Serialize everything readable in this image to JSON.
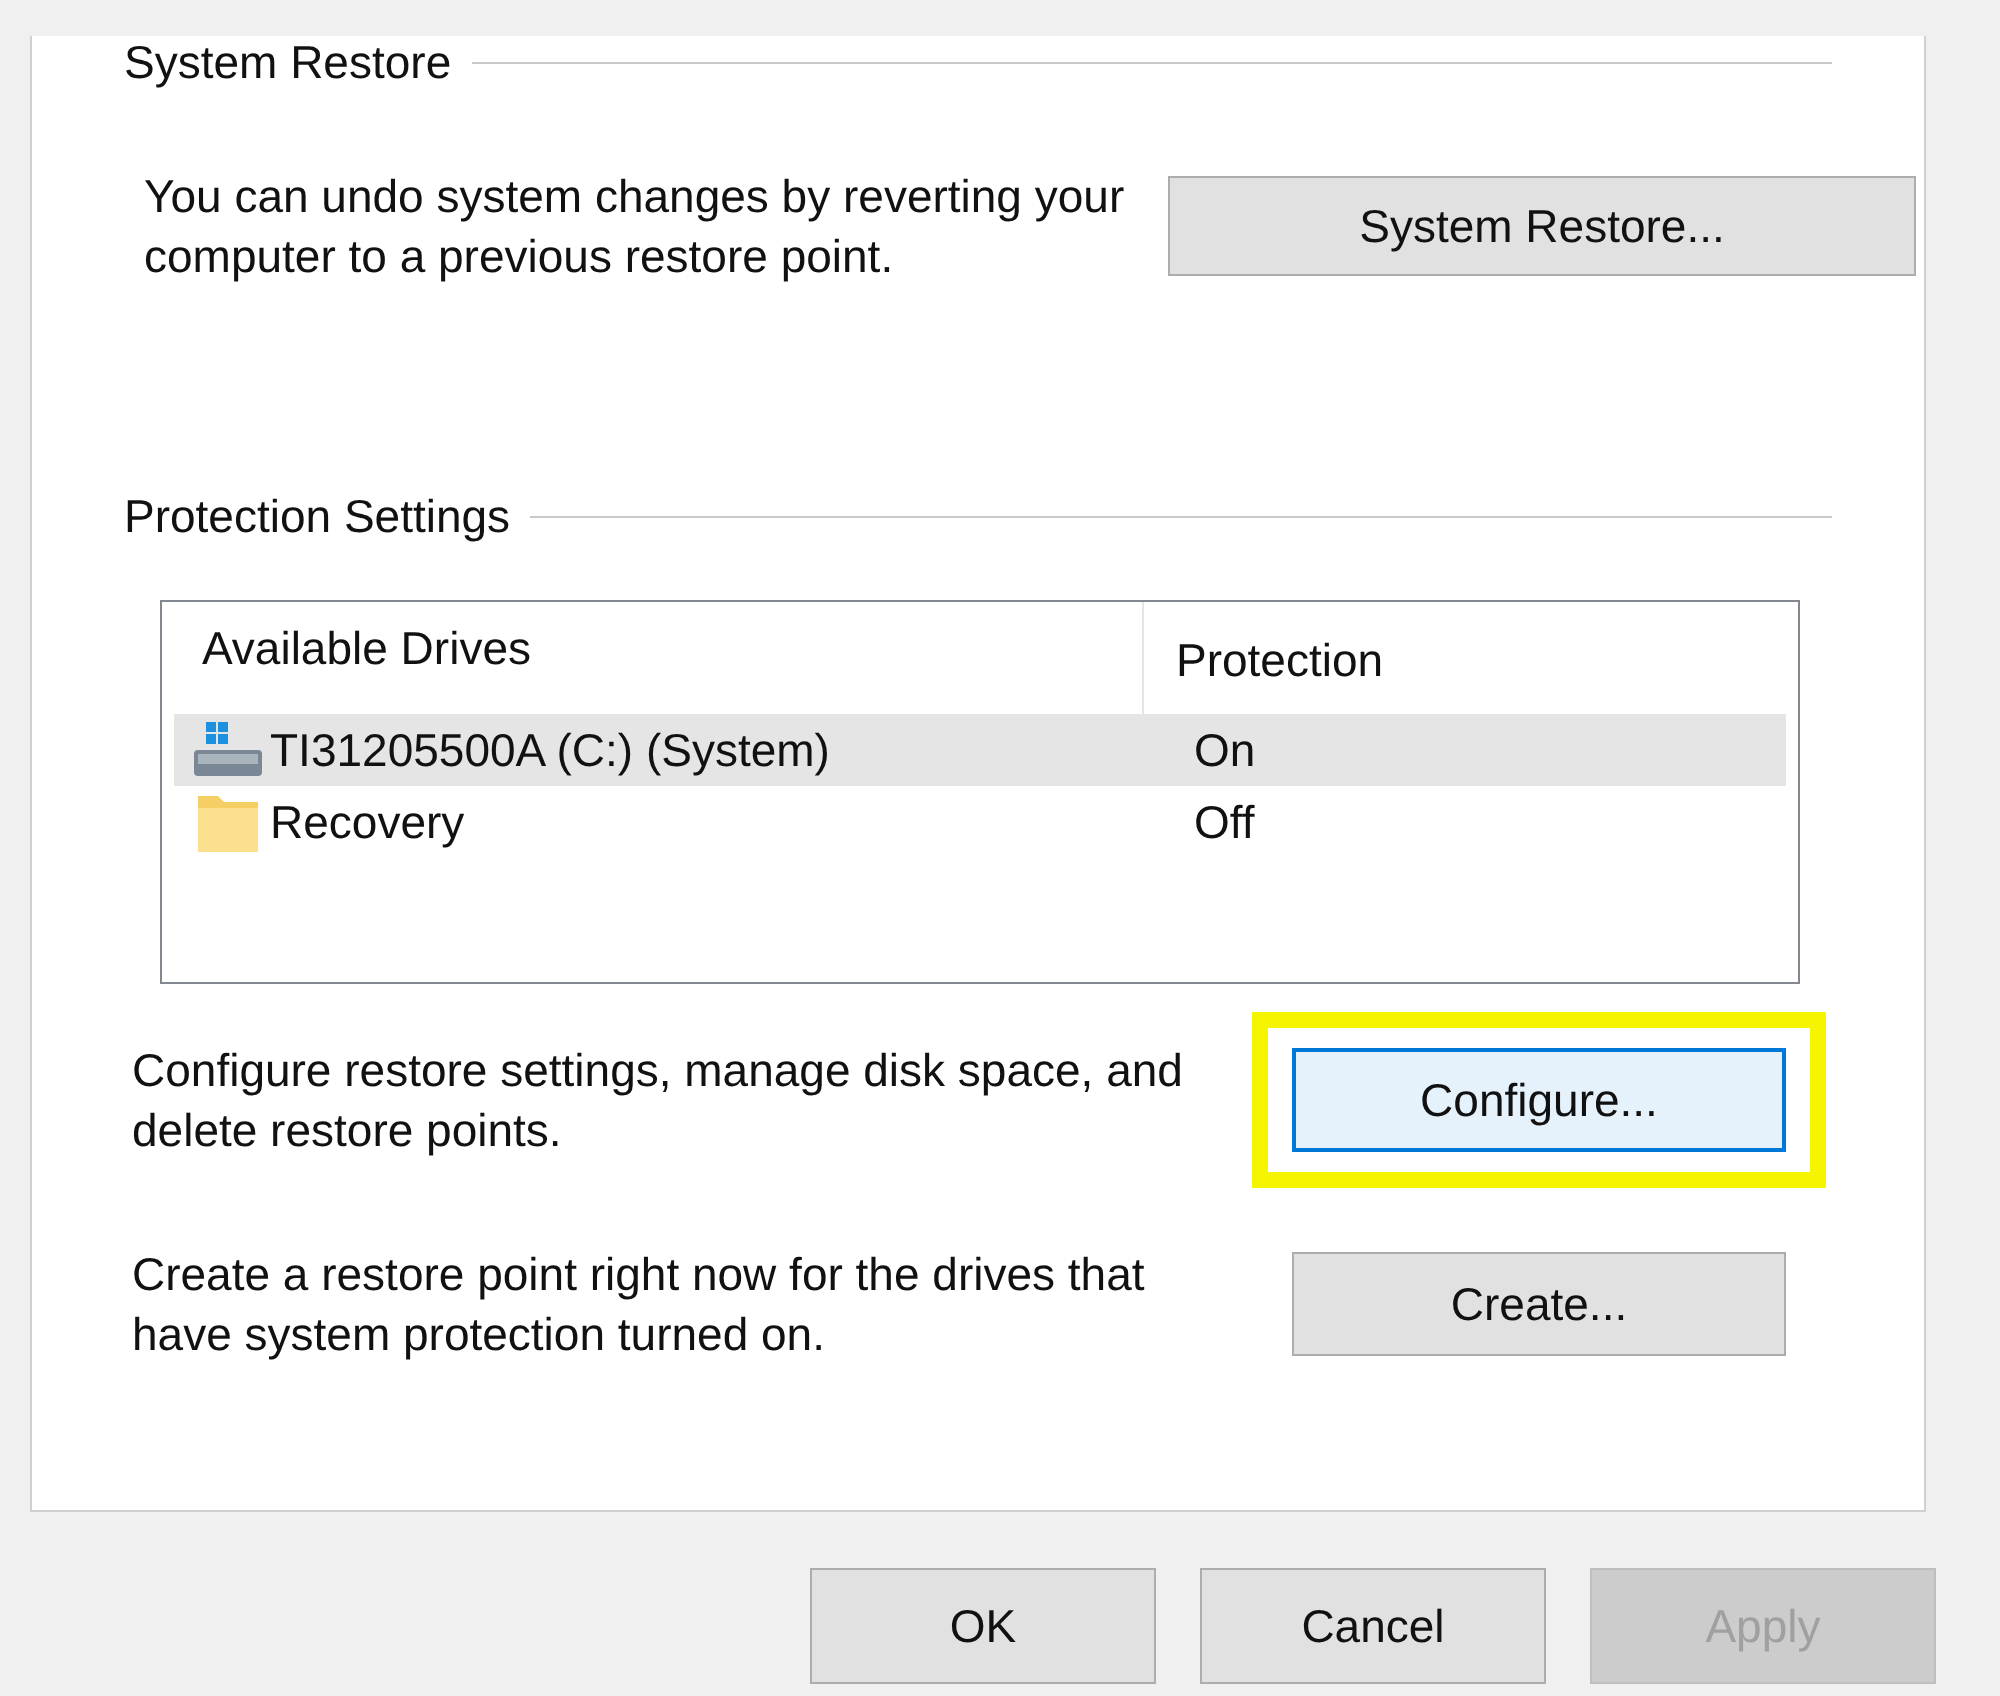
{
  "system_restore": {
    "title": "System Restore",
    "description": "You can undo system changes by reverting your computer to a previous restore point.",
    "button": "System Restore..."
  },
  "protection_settings": {
    "title": "Protection Settings",
    "columns": [
      "Available Drives",
      "Protection"
    ],
    "drives": [
      {
        "name": "TI31205500A (C:) (System)",
        "protection": "On",
        "kind": "system-drive",
        "selected": true
      },
      {
        "name": "Recovery",
        "protection": "Off",
        "kind": "folder",
        "selected": false
      }
    ],
    "actions": [
      {
        "description": "Configure restore settings, manage disk space, and delete restore points.",
        "button": "Configure...",
        "focused": true,
        "highlighted": true
      },
      {
        "description": "Create a restore point right now for the drives that have system protection turned on.",
        "button": "Create...",
        "focused": false,
        "highlighted": false
      }
    ]
  },
  "buttons": [
    {
      "label": "OK",
      "disabled": false
    },
    {
      "label": "Cancel",
      "disabled": false
    },
    {
      "label": "Apply",
      "disabled": true
    }
  ]
}
